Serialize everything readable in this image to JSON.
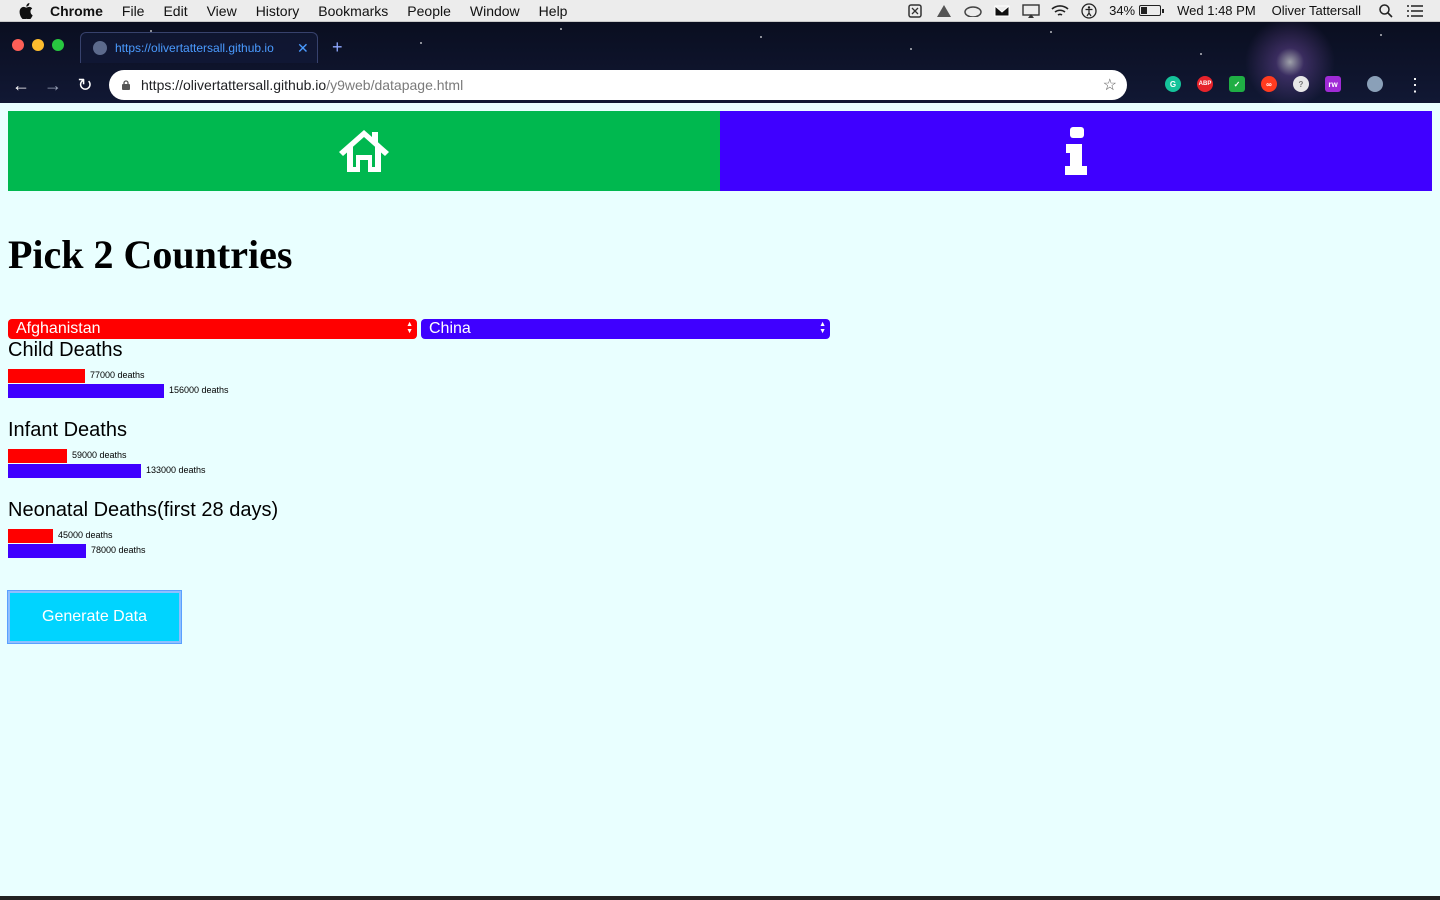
{
  "menubar": {
    "app": "Chrome",
    "items": [
      "File",
      "Edit",
      "View",
      "History",
      "Bookmarks",
      "People",
      "Window",
      "Help"
    ],
    "battery": "34%",
    "battery_level": 0.34,
    "clock": "Wed 1:48 PM",
    "user": "Oliver Tattersall"
  },
  "browser": {
    "tab_title": "https://olivertattersall.github.io",
    "url_host": "https://olivertattersall.github.io",
    "url_path": "/y9web/datapage.html"
  },
  "page": {
    "title": "Pick 2 Countries",
    "country_a": "Afghanistan",
    "country_b": "China",
    "button": "Generate Data",
    "colors": {
      "country_a": "#ff0000",
      "country_b": "#3f00ff",
      "home": "#00b84f",
      "info": "#3f00ff",
      "button": "#00d4ff",
      "background": "#e9ffff"
    },
    "icons": {
      "home": "home-icon",
      "info": "info-icon"
    }
  },
  "chart_data": {
    "type": "bar",
    "series_colors": [
      "#ff0000",
      "#3f00ff"
    ],
    "sections": [
      {
        "title": "Child Deaths",
        "values": [
          77000,
          156000
        ],
        "labels": [
          "77000 deaths",
          "156000 deaths"
        ]
      },
      {
        "title": "Infant Deaths",
        "values": [
          59000,
          133000
        ],
        "labels": [
          "59000 deaths",
          "133000 deaths"
        ]
      },
      {
        "title": "Neonatal Deaths(first 28 days)",
        "values": [
          45000,
          78000
        ],
        "labels": [
          "45000 deaths",
          "78000 deaths"
        ]
      }
    ]
  }
}
